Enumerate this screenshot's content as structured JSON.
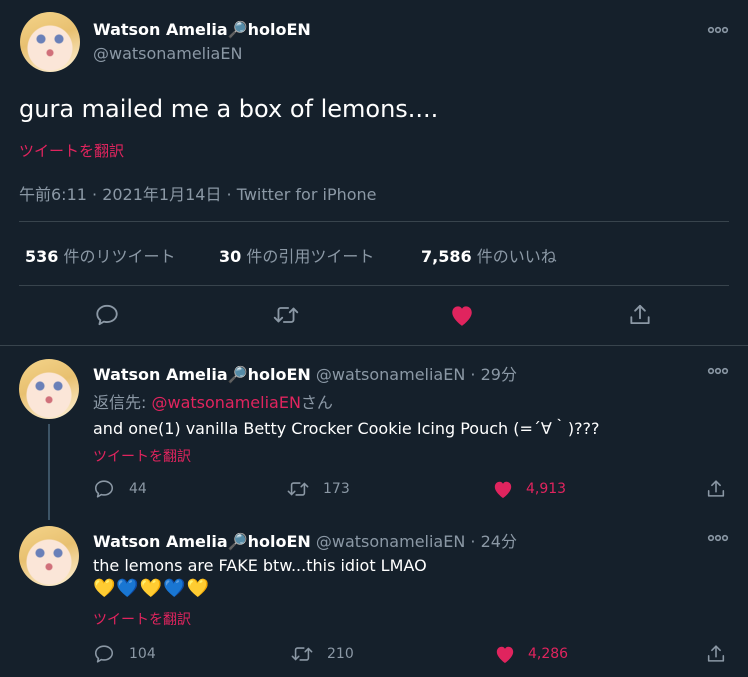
{
  "main": {
    "author_name": "Watson Amelia🔎holoEN",
    "author_handle": "@watsonameliaEN",
    "text": "gura mailed me a box of lemons....",
    "translate": "ツイートを翻訳",
    "timestamp": "午前6:11 · 2021年1月14日 · Twitter for iPhone",
    "stats": {
      "retweets_num": "536",
      "retweets_label": "件のリツイート",
      "quotes_num": "30",
      "quotes_label": "件の引用ツイート",
      "likes_num": "7,586",
      "likes_label": "件のいいね"
    }
  },
  "replies": [
    {
      "author_name": "Watson Amelia🔎holoEN",
      "author_handle": "@watsonameliaEN",
      "time": "· 29分",
      "reply_to_prefix": "返信先: ",
      "reply_to_handle": "@watsonameliaEN",
      "reply_to_suffix": "さん",
      "text": "and one(1) vanilla Betty Crocker Cookie Icing Pouch (=´∀｀)???",
      "translate": "ツイートを翻訳",
      "replies_count": "44",
      "retweets_count": "173",
      "likes_count": "4,913"
    },
    {
      "author_name": "Watson Amelia🔎holoEN",
      "author_handle": "@watsonameliaEN",
      "time": "· 24分",
      "text": "the lemons are FAKE btw...this idiot LMAO",
      "emoji_line": "💛💙💛💙💛",
      "translate": "ツイートを翻訳",
      "replies_count": "104",
      "retweets_count": "210",
      "likes_count": "4,286"
    }
  ],
  "colors": {
    "background": "#15202b",
    "muted": "#8b98a5",
    "accent_pink": "#e0245e",
    "divider": "#38444d"
  },
  "icons": [
    "more-icon",
    "reply-icon",
    "retweet-icon",
    "heart-icon",
    "share-icon"
  ]
}
